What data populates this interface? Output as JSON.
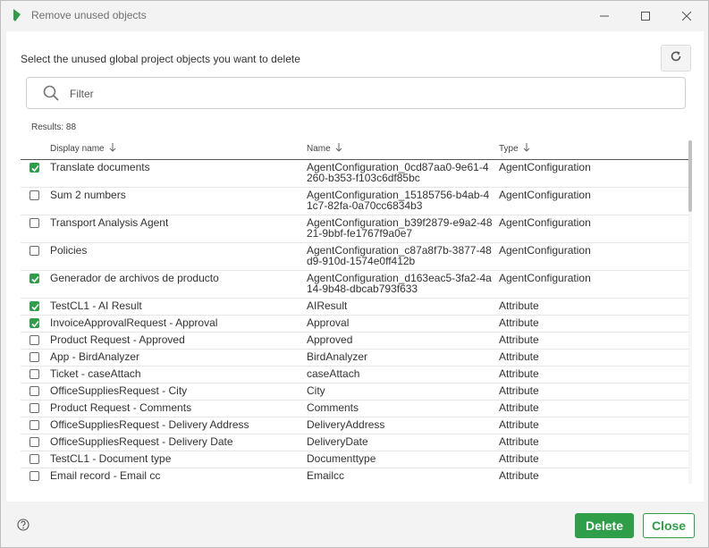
{
  "window": {
    "title": "Remove unused objects",
    "accent_color": "#2e9e49"
  },
  "header": {
    "instructions": "Select the unused global project objects you want to delete",
    "refresh_icon": "refresh-icon"
  },
  "filter": {
    "placeholder": "Filter",
    "value": ""
  },
  "results_label": "Results: 88",
  "table": {
    "columns": [
      {
        "label": "Display name",
        "sort_icon": "sort-down-arrow-icon"
      },
      {
        "label": "Name",
        "sort_icon": "sort-down-arrow-icon"
      },
      {
        "label": "Type",
        "sort_icon": "sort-down-arrow-icon"
      }
    ],
    "rows": [
      {
        "checked": true,
        "display": "Translate documents",
        "name": "AgentConfiguration_0cd87aa0-9e61-4260-b353-f103c6df85bc",
        "type": "AgentConfiguration"
      },
      {
        "checked": false,
        "display": "Sum 2 numbers",
        "name": "AgentConfiguration_15185756-b4ab-41c7-82fa-0a70cc6834b3",
        "type": "AgentConfiguration"
      },
      {
        "checked": false,
        "display": "Transport Analysis Agent",
        "name": "AgentConfiguration_b39f2879-e9a2-4821-9bbf-fe1767f9a0e7",
        "type": "AgentConfiguration"
      },
      {
        "checked": false,
        "display": "Policies",
        "name": "AgentConfiguration_c87a8f7b-3877-48d9-910d-1574e0ff412b",
        "type": "AgentConfiguration"
      },
      {
        "checked": true,
        "display": "Generador de archivos de producto",
        "name": "AgentConfiguration_d163eac5-3fa2-4a14-9b48-dbcab793f633",
        "type": "AgentConfiguration"
      },
      {
        "checked": true,
        "display": "TestCL1 - AI Result",
        "name": "AIResult",
        "type": "Attribute"
      },
      {
        "checked": true,
        "display": "InvoiceApprovalRequest - Approval",
        "name": "Approval",
        "type": "Attribute"
      },
      {
        "checked": false,
        "display": "Product Request - Approved",
        "name": "Approved",
        "type": "Attribute"
      },
      {
        "checked": false,
        "display": "App - BirdAnalyzer",
        "name": "BirdAnalyzer",
        "type": "Attribute"
      },
      {
        "checked": false,
        "display": "Ticket - caseAttach",
        "name": "caseAttach",
        "type": "Attribute"
      },
      {
        "checked": false,
        "display": "OfficeSuppliesRequest - City",
        "name": "City",
        "type": "Attribute"
      },
      {
        "checked": false,
        "display": "Product Request - Comments",
        "name": "Comments",
        "type": "Attribute"
      },
      {
        "checked": false,
        "display": "OfficeSuppliesRequest - Delivery Address",
        "name": "DeliveryAddress",
        "type": "Attribute"
      },
      {
        "checked": false,
        "display": "OfficeSuppliesRequest - Delivery Date",
        "name": "DeliveryDate",
        "type": "Attribute"
      },
      {
        "checked": false,
        "display": "TestCL1 - Document type",
        "name": "Documenttype",
        "type": "Attribute"
      },
      {
        "checked": false,
        "display": "Email record - Email cc",
        "name": "Emailcc",
        "type": "Attribute"
      }
    ]
  },
  "footer": {
    "help_icon": "help-icon",
    "delete_label": "Delete",
    "close_label": "Close"
  }
}
